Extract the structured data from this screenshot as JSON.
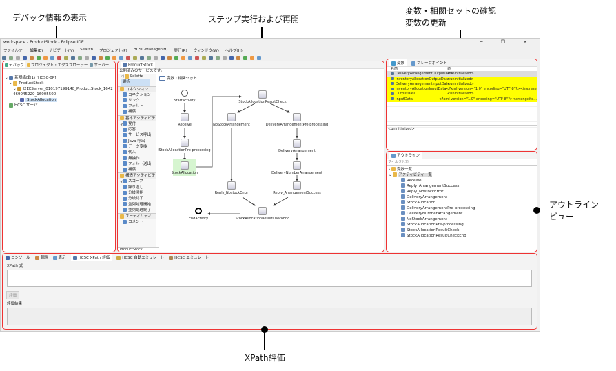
{
  "annotations": {
    "debug": "デバック情報の表示",
    "step": "ステップ実行および再開",
    "vars_line1": "変数・相関セットの確認",
    "vars_line2": "変数の更新",
    "outline_line1": "アウトライン",
    "outline_line2": "ビュー",
    "xpath": "XPath評価"
  },
  "window": {
    "title": "workspace - ProductStock - Eclipse IDE",
    "controls": "─ ❐ ✕"
  },
  "menu": [
    "ファイル(F)",
    "編集(E)",
    "ナビゲート(N)",
    "Search",
    "プロジェクト(P)",
    "HCSC-Manager(H)",
    "実行(R)",
    "ウィンドウ(W)",
    "ヘルプ(H)"
  ],
  "debug_panel": {
    "tabs": [
      "デバッグ",
      "プロジェクト・エクスプローラー",
      "サーバー"
    ],
    "tree": [
      "新規構成(1) [HCSC-BP]",
      "ProductStock",
      "J2EEServer_010197199148_ProductStock_1642469045220_16005500",
      "StockAllocation",
      "HCSC サーバ"
    ]
  },
  "editor": {
    "tab": "ProductStock",
    "subtitle": "公開済みのサービスです。",
    "bottom_tab": "ProductStock",
    "palette": {
      "title": "Palette",
      "select": "選択",
      "groups": [
        {
          "label": "コネクション",
          "items": [
            "コネクション",
            "リンク",
            "フォルト",
            "補償"
          ]
        },
        {
          "label": "基本アクティビティ",
          "items": [
            "受付",
            "応答",
            "サービス呼出",
            "Java 呼出",
            "データ変換",
            "代入",
            "無操作",
            "フォルト送出",
            "補償"
          ]
        },
        {
          "label": "構造アクティビティ",
          "items": [
            "スコープ",
            "繰り返し",
            "分岐開始",
            "分岐終了",
            "並列処理開始",
            "並列処理終了"
          ]
        },
        {
          "label": "ユーティリティ",
          "items": [
            "コメント"
          ]
        }
      ]
    },
    "var_set": "変数・相関セット",
    "nodes": [
      "StartActivity",
      "Receive",
      "StockAllocationPre-processing",
      "StockAllocation",
      "StockAllocationResultCheck",
      "NoStockArrangement",
      "DeliveryArrangementPre-processing",
      "DeliveryArrangement",
      "DeliveryNumberArrangement",
      "Reply_NostockError",
      "Reply_ArrangementSuccess",
      "StockAllocationResultCheckEnd",
      "EndActivity"
    ]
  },
  "variables": {
    "tabs": [
      "変数",
      "ブレークポイント"
    ],
    "col_name": "名前",
    "col_value": "値",
    "rows": [
      {
        "name": "DeliveryArrangementOutputData",
        "value": "<uninitialized>"
      },
      {
        "name": "InventoryAllocationOutputData",
        "value": "<uninitialized>"
      },
      {
        "name": "DeliveryArrangementInputData",
        "value": "<uninitialized>"
      },
      {
        "name": "InventoryAllocationInputData",
        "value": "<?xml version=\"1.0\" encoding=\"UTF-8\"?><inv:reservat..."
      },
      {
        "name": "OutputData",
        "value": "<uninitialized>"
      },
      {
        "name": "InputData",
        "value": "<?xml version=\"1.0\" encoding=\"UTF-8\"?><arrangeite..."
      }
    ],
    "detail": "<uninitialized>",
    "highlight_color": "#ffff00"
  },
  "outline": {
    "tab": "アウトライン",
    "filter_placeholder": "フィルタ入力",
    "groups": [
      "変数一覧",
      "アクティビティ一覧"
    ],
    "items": [
      "Receive",
      "Reply_ArrangementSuccess",
      "Reply_NostockError",
      "DeliveryArrangement",
      "StockAllocation",
      "DeliveryArrangementPre-processing",
      "DeliveryNumberArrangement",
      "NoStockArrangement",
      "StockAllocationPre-processing",
      "StockAllocationResultCheck",
      "StockAllocationResultCheckEnd"
    ]
  },
  "bottom": {
    "tabs": [
      "コンソール",
      "問題",
      "表示",
      "HCSC XPath 評価",
      "HCSC 自動エミュレート",
      "HCSC エミュレート"
    ],
    "xpath_label": "XPath 式",
    "eval_button": "評価",
    "result_label": "評価結果"
  },
  "colors": {
    "highlight_border": "#ee3333",
    "active_node": "#d6f5d0"
  }
}
